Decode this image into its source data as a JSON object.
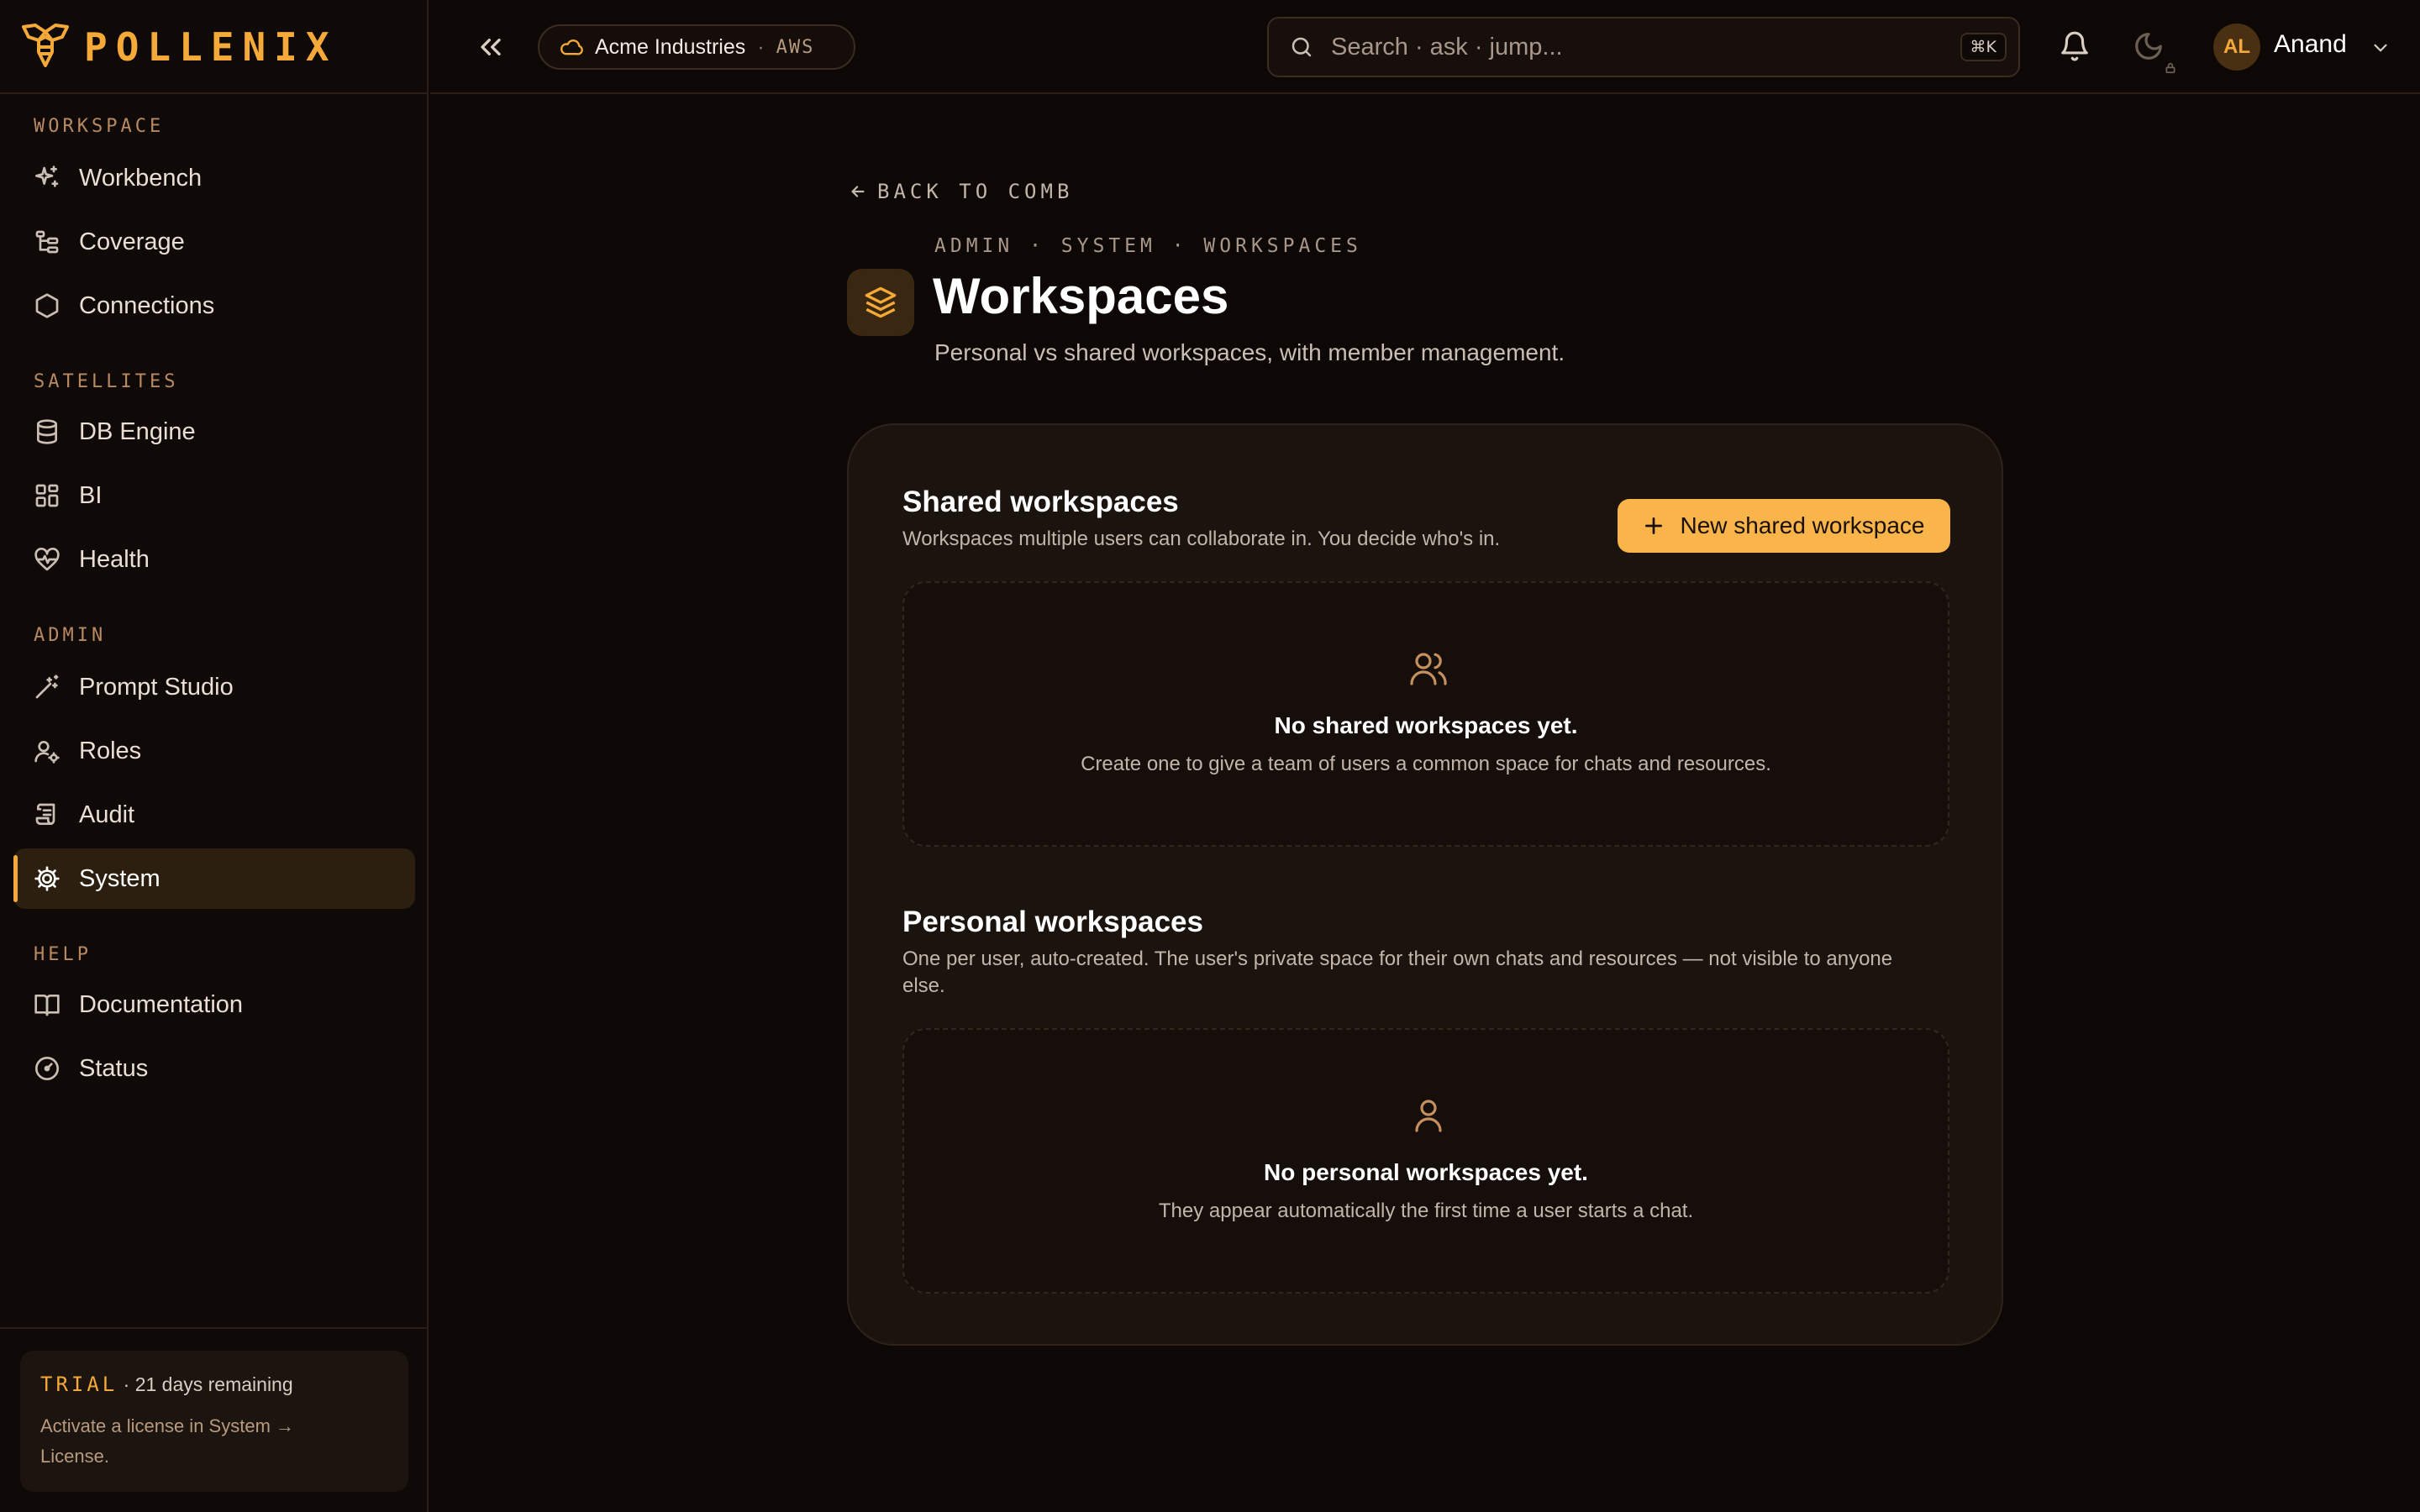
{
  "brand": {
    "name": "POLLENIX",
    "accent": "#f5a938"
  },
  "sidebar": {
    "sections": [
      {
        "label": "WORKSPACE",
        "items": [
          {
            "label": "Workbench",
            "icon": "sparkles-icon"
          },
          {
            "label": "Coverage",
            "icon": "tree-icon"
          },
          {
            "label": "Connections",
            "icon": "hexagon-icon"
          }
        ]
      },
      {
        "label": "SATELLITES",
        "items": [
          {
            "label": "DB Engine",
            "icon": "database-icon"
          },
          {
            "label": "BI",
            "icon": "dashboard-icon"
          },
          {
            "label": "Health",
            "icon": "heart-pulse-icon"
          }
        ]
      },
      {
        "label": "ADMIN",
        "items": [
          {
            "label": "Prompt Studio",
            "icon": "wand-icon"
          },
          {
            "label": "Roles",
            "icon": "user-cog-icon"
          },
          {
            "label": "Audit",
            "icon": "scroll-icon"
          },
          {
            "label": "System",
            "icon": "gear-icon",
            "active": true
          }
        ]
      },
      {
        "label": "HELP",
        "items": [
          {
            "label": "Documentation",
            "icon": "book-icon"
          },
          {
            "label": "Status",
            "icon": "gauge-icon"
          }
        ]
      }
    ],
    "trial": {
      "tag": "TRIAL",
      "remaining": "· 21 days remaining",
      "note": "Activate a license in System → License."
    }
  },
  "topbar": {
    "tenant": {
      "name": "Acme Industries",
      "separator": "·",
      "cloud": "AWS"
    },
    "search": {
      "placeholder": "Search · ask · jump...",
      "shortcut": "⌘K"
    },
    "user": {
      "initials": "AL",
      "name": "Anand"
    }
  },
  "page": {
    "back_label": "BACK TO COMB",
    "breadcrumb": "ADMIN · SYSTEM · WORKSPACES",
    "title": "Workspaces",
    "subtitle": "Personal vs shared workspaces, with member management."
  },
  "shared": {
    "title": "Shared workspaces",
    "description": "Workspaces multiple users can collaborate in. You decide who's in.",
    "new_button": "New shared workspace",
    "empty_title": "No shared workspaces yet.",
    "empty_desc": "Create one to give a team of users a common space for chats and resources."
  },
  "personal": {
    "title": "Personal workspaces",
    "description": "One per user, auto-created. The user's private space for their own chats and resources — not visible to anyone else.",
    "empty_title": "No personal workspaces yet.",
    "empty_desc": "They appear automatically the first time a user starts a chat."
  }
}
